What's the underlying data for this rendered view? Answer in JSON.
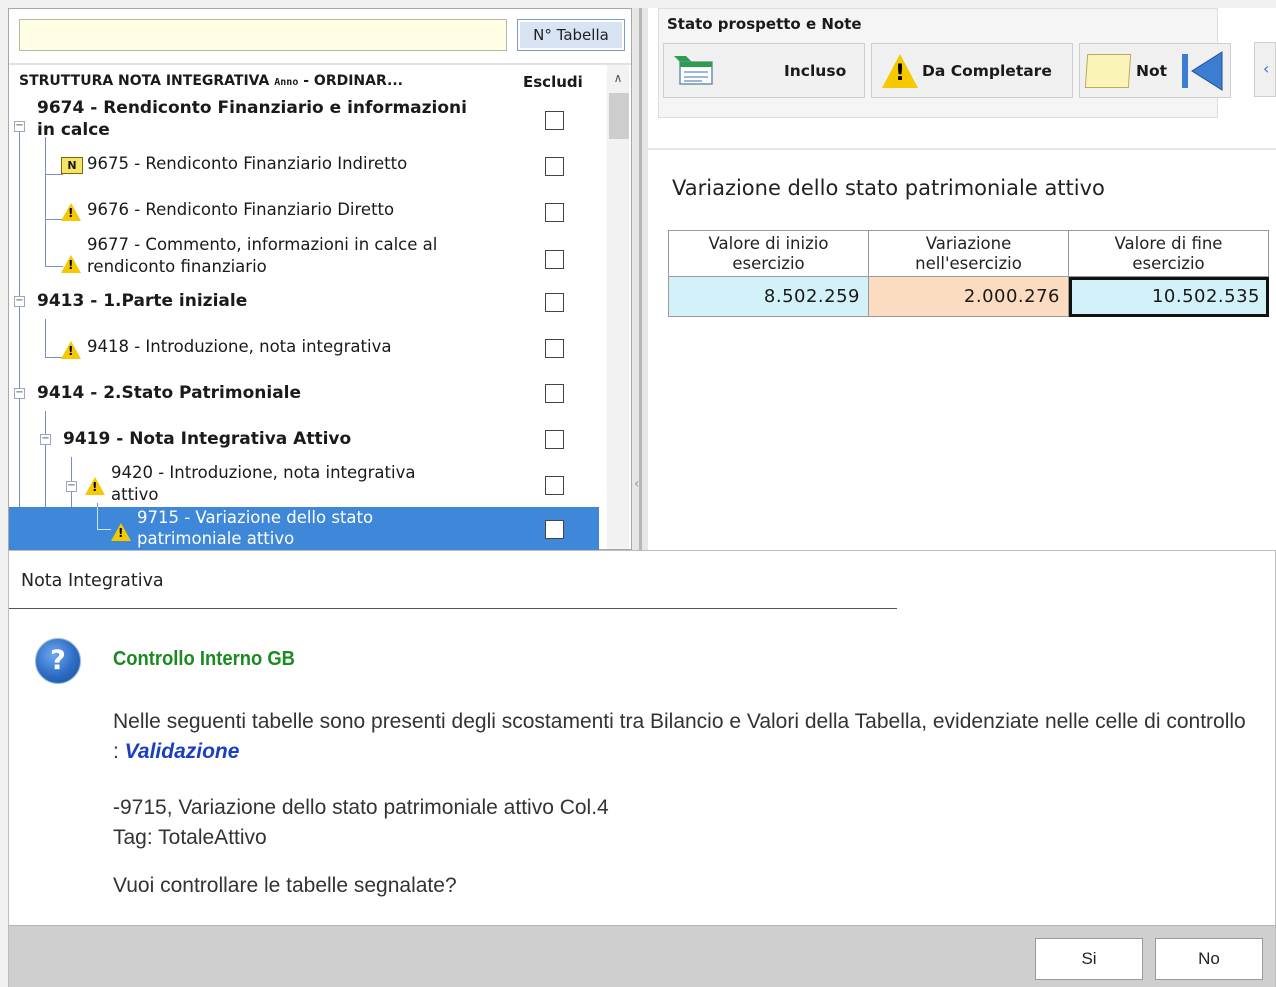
{
  "left_panel": {
    "search_value": "",
    "ntabella_label": "N° Tabella",
    "header_title_main": "STRUTTURA NOTA INTEGRATIVA ",
    "header_anno": "Anno",
    "header_title_rest": " - ORDINAR...",
    "header_escludi": "Escludi",
    "tree": [
      {
        "label_line1": "9674 - Rendiconto Finanziario e informazioni",
        "label_line2": "in calce",
        "bold": true,
        "expander": "minus",
        "excluded": false
      },
      {
        "label": "9675 - Rendiconto Finanziario Indiretto",
        "icon": "note-n-icon",
        "icon_text": "N",
        "excluded": false
      },
      {
        "label": "9676 - Rendiconto Finanziario Diretto",
        "icon": "warning-icon",
        "excluded": false
      },
      {
        "label_line1": "9677 - Commento, informazioni in calce al",
        "label_line2": "rendiconto finanziario",
        "icon": "warning-icon",
        "excluded": false
      },
      {
        "label": "9413 - 1.Parte iniziale",
        "bold": true,
        "expander": "minus",
        "excluded": false
      },
      {
        "label": "9418 - Introduzione, nota integrativa",
        "icon": "warning-icon",
        "excluded": false
      },
      {
        "label": "9414 - 2.Stato Patrimoniale",
        "bold": true,
        "expander": "minus",
        "excluded": false
      },
      {
        "label": "9419 - Nota Integrativa Attivo",
        "bold": true,
        "expander": "minus",
        "excluded": false
      },
      {
        "label_line1": "9420 - Introduzione, nota integrativa",
        "label_line2": "attivo",
        "icon": "warning-icon",
        "expander": "minus",
        "excluded": false
      },
      {
        "label_line1": "9715 - Variazione dello stato",
        "label_line2": "patrimoniale attivo",
        "icon": "warning-icon",
        "selected": true,
        "excluded": false
      }
    ]
  },
  "right_panel": {
    "stato_title": "Stato prospetto e Note",
    "buttons": {
      "incluso": "Incluso",
      "da_completare": "Da Completare",
      "note": "Not"
    },
    "prospetto_title": "Variazione dello stato patrimoniale attivo",
    "table": {
      "headers": [
        {
          "line1": "Valore di inizio",
          "line2": "esercizio"
        },
        {
          "line1": "Variazione",
          "line2": "nell'esercizio"
        },
        {
          "line1": "Valore di fine",
          "line2": "esercizio"
        }
      ],
      "values": [
        "8.502.259",
        "2.000.276",
        "10.502.535"
      ]
    }
  },
  "dialog": {
    "title": "Nota Integrativa",
    "heading": "Controllo Interno GB",
    "body_text": "Nelle seguenti tabelle sono presenti degli scostamenti tra Bilancio e Valori della Tabella, evidenziate nelle celle di controllo : ",
    "body_highlight": "Validazione",
    "detail_line1": "-9715, Variazione dello stato patrimoniale attivo Col.4",
    "detail_line2": "Tag: TotaleAttivo",
    "question": "Vuoi controllare le tabelle segnalate?",
    "btn_si": "Si",
    "btn_no": "No"
  },
  "colors": {
    "selection": "#3f87d8",
    "cell_cyan": "#d3f1f8",
    "cell_orange": "#fbdcc1",
    "heading_green": "#1a8a22",
    "link_blue": "#1a3fc0"
  }
}
